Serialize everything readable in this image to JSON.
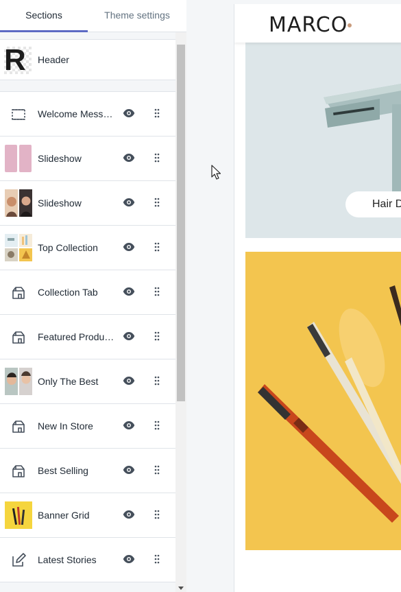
{
  "tabs": {
    "sections": "Sections",
    "theme_settings": "Theme settings"
  },
  "header_row": {
    "label": "Header",
    "thumb_letter": "R"
  },
  "sections": [
    {
      "label": "Welcome Message",
      "icon": "dashed-box-icon"
    },
    {
      "label": "Slideshow",
      "icon": "pink-slides-thumbnail"
    },
    {
      "label": "Slideshow",
      "icon": "portrait-thumbnail"
    },
    {
      "label": "Top Collection",
      "icon": "collection-thumbnail"
    },
    {
      "label": "Collection Tab",
      "icon": "store-icon"
    },
    {
      "label": "Featured Products",
      "icon": "store-icon"
    },
    {
      "label": "Only The Best",
      "icon": "faces-thumbnail"
    },
    {
      "label": "New In Store",
      "icon": "store-icon"
    },
    {
      "label": "Best Selling",
      "icon": "store-icon"
    },
    {
      "label": "Banner Grid",
      "icon": "banner-thumbnail"
    },
    {
      "label": "Latest Stories",
      "icon": "edit-icon"
    }
  ],
  "preview": {
    "logo": "MARCO",
    "banner_button": "Hair D"
  },
  "colors": {
    "accent": "#5c6ac4",
    "banner_yellow": "#f3c54f",
    "banner_gray": "#dfe7ea",
    "logo_dot": "#c99b7c"
  }
}
